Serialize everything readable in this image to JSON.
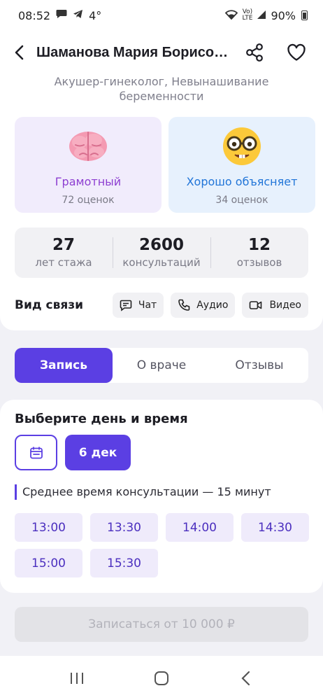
{
  "status_bar": {
    "time": "08:52",
    "temp": "4°",
    "signal_label": "LTE",
    "battery": "90%"
  },
  "header": {
    "title": "Шаманова Мария Борисов…",
    "back_icon": "chevron-left-icon",
    "share_icon": "share-icon",
    "favorite_icon": "heart-icon"
  },
  "doctor": {
    "specialty": "Акушер-гинеколог, Невынашивание беременности"
  },
  "ratings": [
    {
      "emoji": "brain",
      "label": "Грамотный",
      "count": "72 оценок",
      "bg": "#f1ecfc",
      "color": "#8d3ed1"
    },
    {
      "emoji": "nerd-face",
      "label": "Хорошо объясняет",
      "count": "34 оценок",
      "bg": "#e7f1fd",
      "color": "#2175d8"
    }
  ],
  "stats": [
    {
      "value": "27",
      "label": "лет стажа"
    },
    {
      "value": "2600",
      "label": "консультаций"
    },
    {
      "value": "12",
      "label": "отзывов"
    }
  ],
  "contact": {
    "title": "Вид связи",
    "options": [
      {
        "icon": "chat-icon",
        "label": "Чат"
      },
      {
        "icon": "phone-icon",
        "label": "Аудио"
      },
      {
        "icon": "video-icon",
        "label": "Видео"
      }
    ]
  },
  "tabs": [
    {
      "label": "Запись",
      "active": true
    },
    {
      "label": "О враче",
      "active": false
    },
    {
      "label": "Отзывы",
      "active": false
    }
  ],
  "booking": {
    "title": "Выберите день и время",
    "calendar_icon": "calendar-icon",
    "selected_date": "6 дек",
    "duration_note": "Среднее время консультации — 15 минут",
    "slots": [
      "13:00",
      "13:30",
      "14:00",
      "14:30",
      "15:00",
      "15:30"
    ]
  },
  "cta": {
    "label": "Записаться от 10 000 ₽",
    "enabled": false
  },
  "colors": {
    "accent": "#5b3fe3",
    "background": "#f1f1f6",
    "slot_bg": "#efebfb"
  }
}
